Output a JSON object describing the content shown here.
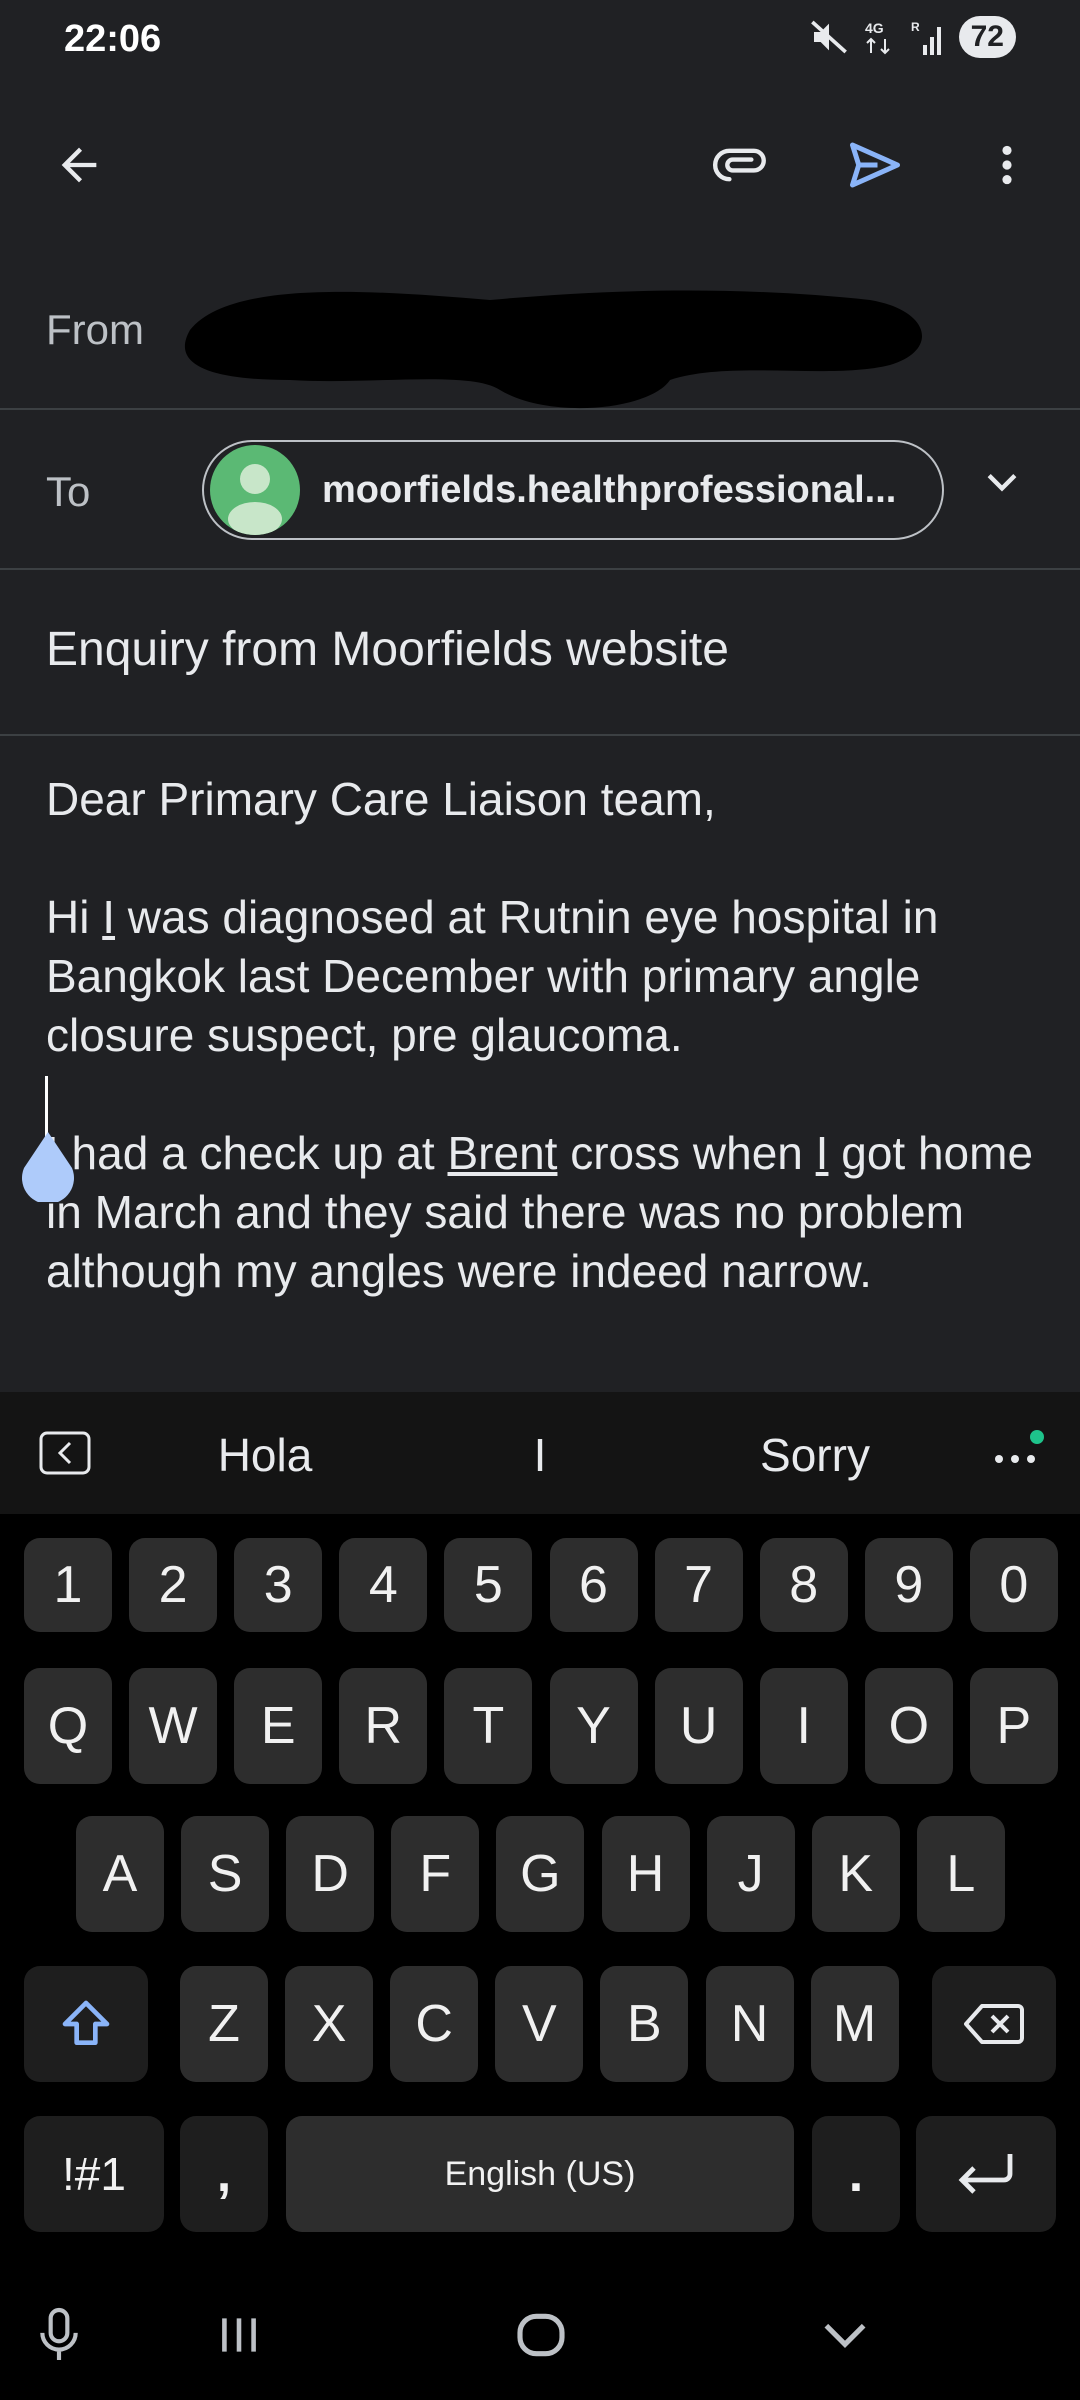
{
  "status": {
    "time": "22:06",
    "battery": "72"
  },
  "compose": {
    "from_label": "From",
    "to_label": "To",
    "to_recipient": "moorfields.healthprofessional...",
    "subject": "Enquiry from Moorfields website"
  },
  "body": {
    "greeting": "Dear Primary Care Liaison team,",
    "p1_a": "Hi ",
    "p1_i": "I",
    "p1_b": " was diagnosed at Rutnin eye hospital in Bangkok last December with primary angle closure suspect, pre glaucoma.",
    "p2_a": "I had a check up at ",
    "p2_brent": "Brent",
    "p2_b": " cross when ",
    "p2_i": "I",
    "p2_c": " got home in March and they said there was no problem although my angles were indeed narrow."
  },
  "keyboard": {
    "suggestions": [
      "Hola",
      "I",
      "Sorry"
    ],
    "number_row": [
      "1",
      "2",
      "3",
      "4",
      "5",
      "6",
      "7",
      "8",
      "9",
      "0"
    ],
    "row1": [
      "Q",
      "W",
      "E",
      "R",
      "T",
      "Y",
      "U",
      "I",
      "O",
      "P"
    ],
    "row2": [
      "A",
      "S",
      "D",
      "F",
      "G",
      "H",
      "J",
      "K",
      "L"
    ],
    "row3": [
      "Z",
      "X",
      "C",
      "V",
      "B",
      "N",
      "M"
    ],
    "symbols_key": "!#1",
    "comma_key": ",",
    "space_label": "English (US)",
    "period_key": "."
  },
  "colors": {
    "accent": "#8ab4f8",
    "avatar": "#5bb974",
    "background": "#202124"
  }
}
